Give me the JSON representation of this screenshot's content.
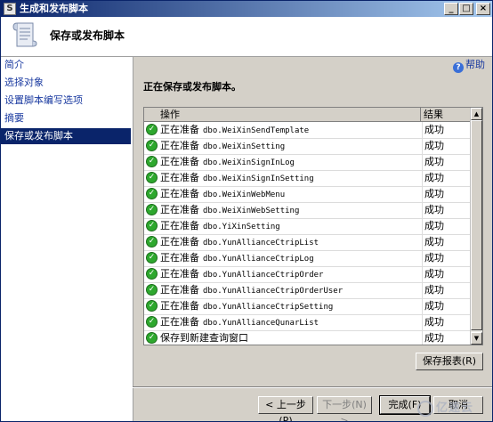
{
  "window": {
    "title": "生成和发布脚本",
    "controls": {
      "minimize": "_",
      "maximize": "□",
      "close": "×"
    }
  },
  "header": {
    "icon": "script-scroll-icon",
    "title": "保存或发布脚本"
  },
  "nav": {
    "items": [
      {
        "label": "简介",
        "selected": false
      },
      {
        "label": "选择对象",
        "selected": false
      },
      {
        "label": "设置脚本编写选项",
        "selected": false
      },
      {
        "label": "摘要",
        "selected": false
      },
      {
        "label": "保存或发布脚本",
        "selected": true
      }
    ]
  },
  "help": {
    "label": "帮助",
    "icon": "help-icon"
  },
  "status_text": "正在保存或发布脚本。",
  "grid": {
    "columns": [
      "操作",
      "结果"
    ],
    "rows": [
      {
        "prefix": "正在准备",
        "object": "dbo.WeiXinSendTemplate",
        "result": "成功"
      },
      {
        "prefix": "正在准备",
        "object": "dbo.WeiXinSetting",
        "result": "成功"
      },
      {
        "prefix": "正在准备",
        "object": "dbo.WeiXinSignInLog",
        "result": "成功"
      },
      {
        "prefix": "正在准备",
        "object": "dbo.WeiXinSignInSetting",
        "result": "成功"
      },
      {
        "prefix": "正在准备",
        "object": "dbo.WeiXinWebMenu",
        "result": "成功"
      },
      {
        "prefix": "正在准备",
        "object": "dbo.WeiXinWebSetting",
        "result": "成功"
      },
      {
        "prefix": "正在准备",
        "object": "dbo.YiXinSetting",
        "result": "成功"
      },
      {
        "prefix": "正在准备",
        "object": "dbo.YunAllianceCtripList",
        "result": "成功"
      },
      {
        "prefix": "正在准备",
        "object": "dbo.YunAllianceCtripLog",
        "result": "成功"
      },
      {
        "prefix": "正在准备",
        "object": "dbo.YunAllianceCtripOrder",
        "result": "成功"
      },
      {
        "prefix": "正在准备",
        "object": "dbo.YunAllianceCtripOrderUser",
        "result": "成功"
      },
      {
        "prefix": "正在准备",
        "object": "dbo.YunAllianceCtripSetting",
        "result": "成功"
      },
      {
        "prefix": "正在准备",
        "object": "dbo.YunAllianceQunarList",
        "result": "成功"
      },
      {
        "prefix": "保存到新建查询窗口",
        "object": "",
        "result": "成功"
      }
    ]
  },
  "buttons": {
    "save_report": "保存报表(R)",
    "back": "< 上一步(P)",
    "next": "下一步(N) >",
    "finish": "完成(F)",
    "cancel": "取消"
  },
  "watermark": "亿速云"
}
